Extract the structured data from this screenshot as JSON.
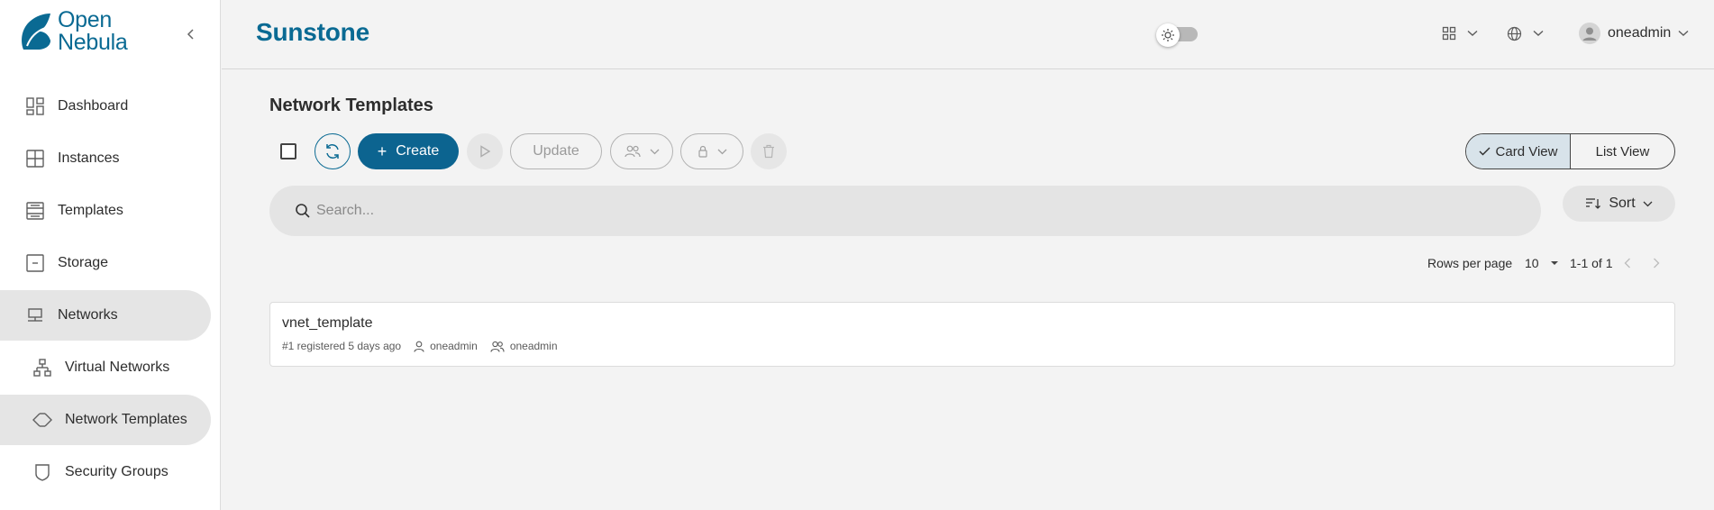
{
  "logo": {
    "line1": "Open",
    "line2": "Nebula"
  },
  "sidebar": {
    "items": [
      {
        "label": "Dashboard",
        "icon": "dashboard-icon"
      },
      {
        "label": "Instances",
        "icon": "instances-icon"
      },
      {
        "label": "Templates",
        "icon": "templates-icon"
      },
      {
        "label": "Storage",
        "icon": "storage-icon"
      },
      {
        "label": "Networks",
        "icon": "networks-icon",
        "active": true
      },
      {
        "label": "Virtual Networks",
        "icon": "virtual-networks-icon",
        "sub": true
      },
      {
        "label": "Network Templates",
        "icon": "network-templates-icon",
        "sub": true,
        "active": true
      },
      {
        "label": "Security Groups",
        "icon": "shield-icon",
        "sub": true
      }
    ]
  },
  "header": {
    "brand": "Sunstone",
    "user": "oneadmin"
  },
  "main": {
    "title": "Network Templates",
    "toolbar": {
      "create_label": "Create",
      "update_label": "Update"
    },
    "view": {
      "card_label": "Card View",
      "list_label": "List View",
      "selected": "Card View"
    },
    "search": {
      "placeholder": "Search..."
    },
    "sort_label": "Sort",
    "pagination": {
      "rows_label": "Rows per page",
      "rows_value": "10",
      "range": "1-1 of 1"
    },
    "cards": [
      {
        "name": "vnet_template",
        "meta": "#1 registered 5 days ago",
        "owner": "oneadmin",
        "group": "oneadmin"
      }
    ]
  },
  "colors": {
    "brand": "#0a6a93",
    "primary_button": "#0c6490",
    "background": "#f3f3f3"
  }
}
